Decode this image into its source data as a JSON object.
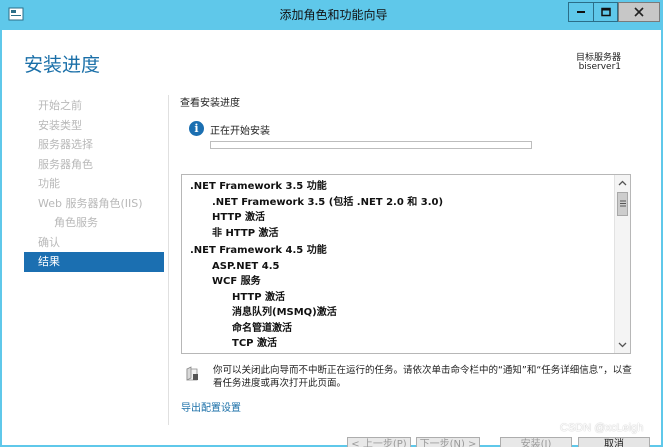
{
  "window": {
    "title": "添加角色和功能向导"
  },
  "header": {
    "page_title": "安装进度",
    "server_label": "目标服务器",
    "server_name": "biserver1"
  },
  "nav": {
    "items": [
      {
        "label": "开始之前"
      },
      {
        "label": "安装类型"
      },
      {
        "label": "服务器选择"
      },
      {
        "label": "服务器角色"
      },
      {
        "label": "功能"
      },
      {
        "label": "Web 服务器角色(IIS)"
      },
      {
        "label": "角色服务"
      },
      {
        "label": "确认"
      },
      {
        "label": "结果"
      }
    ]
  },
  "main": {
    "section_label": "查看安装进度",
    "status_text": "正在开始安装",
    "progress": 0.0,
    "features": [
      {
        "label": ".NET Framework 3.5 功能"
      },
      {
        "label": ".NET Framework 3.5 (包括 .NET 2.0 和 3.0)"
      },
      {
        "label": "HTTP 激活"
      },
      {
        "label": "非 HTTP 激活"
      },
      {
        "label": ".NET Framework 4.5 功能"
      },
      {
        "label": "ASP.NET 4.5"
      },
      {
        "label": "WCF 服务"
      },
      {
        "label": "HTTP 激活"
      },
      {
        "label": "消息队列(MSMQ)激活"
      },
      {
        "label": "命名管道激活"
      },
      {
        "label": "TCP 激活"
      }
    ],
    "note": "你可以关闭此向导而不中断正在运行的任务。请依次单击命令栏中的“通知”和“任务详细信息”，以查看任务进度或再次打开此页面。",
    "export_link": "导出配置设置"
  },
  "buttons": {
    "prev": "< 上一步(P)",
    "next": "下一步(N) >",
    "install": "安装(I)",
    "cancel": "取消"
  },
  "watermark": "CSDN @xcLeigh",
  "colors": {
    "titlebar": "#5fc8ea",
    "accent": "#1b6fb1",
    "link": "#1a6fa8"
  }
}
